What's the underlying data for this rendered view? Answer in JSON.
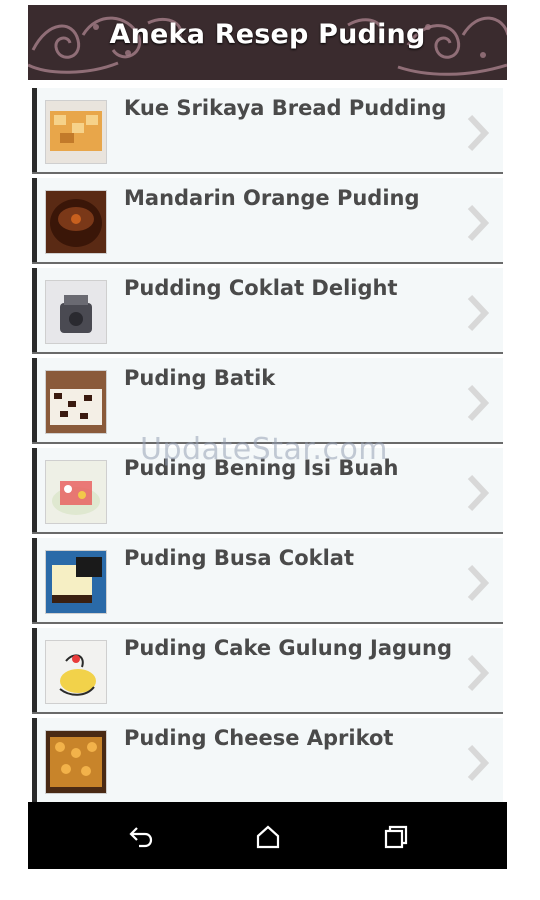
{
  "header": {
    "title": "Aneka Resep Puding"
  },
  "recipes": [
    {
      "label": "Kue Srikaya Bread Pudding",
      "thumb": "bread-pudding-thumbnail"
    },
    {
      "label": "Mandarin Orange Puding",
      "thumb": "orange-pudding-thumbnail"
    },
    {
      "label": "Pudding Coklat Delight",
      "thumb": "chocolate-delight-thumbnail"
    },
    {
      "label": "Puding Batik",
      "thumb": "batik-pudding-thumbnail"
    },
    {
      "label": "Puding Bening Isi Buah",
      "thumb": "fruit-pudding-thumbnail"
    },
    {
      "label": "Puding Busa Coklat",
      "thumb": "chocolate-foam-thumbnail"
    },
    {
      "label": "Puding Cake Gulung Jagung",
      "thumb": "corn-roll-cake-thumbnail"
    },
    {
      "label": "Puding Cheese Aprikot",
      "thumb": "apricot-cheese-thumbnail"
    }
  ],
  "watermark": "UpdateStar.com",
  "colors": {
    "header_bg": "#3a2b2e",
    "header_ornament": "#a07a84",
    "row_bg": "#f4f8f9",
    "text": "#4a4a4a",
    "nav_bg": "#000000"
  },
  "nav": {
    "back": "back-icon",
    "home": "home-icon",
    "recents": "recent-apps-icon"
  }
}
